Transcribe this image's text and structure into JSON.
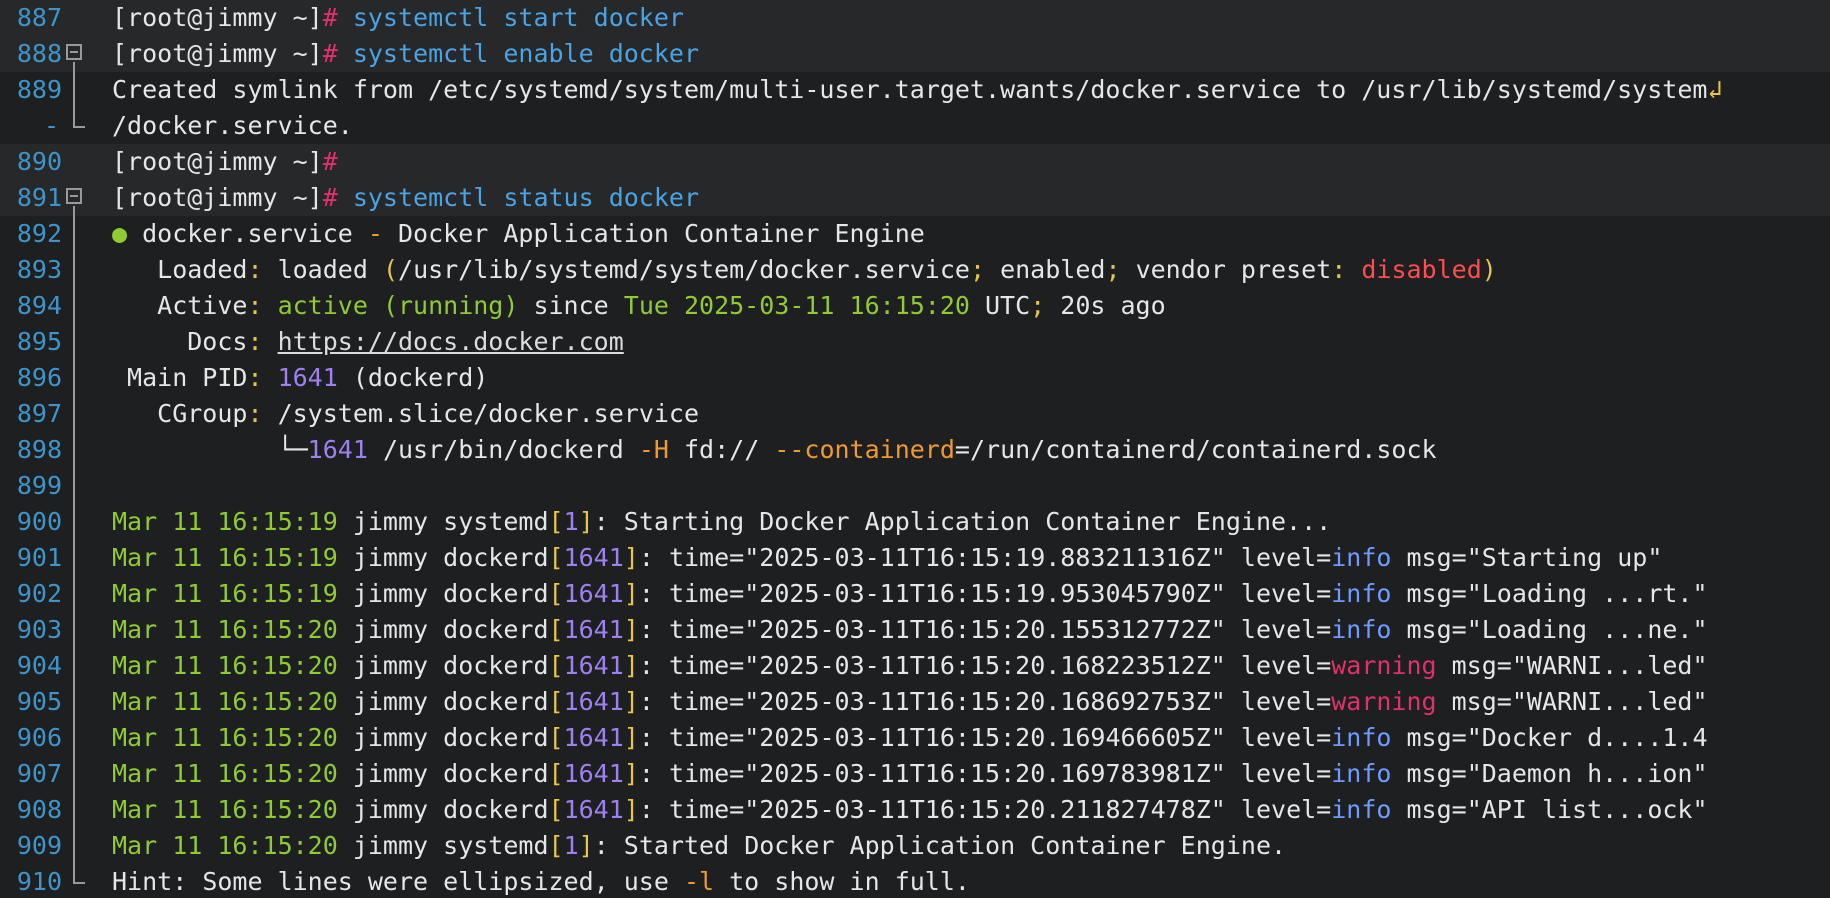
{
  "lines": [
    {
      "num": "887",
      "prompt": "[root@jimmy ~]",
      "hash": "#",
      "cmd": " systemctl start docker"
    },
    {
      "num": "888",
      "prompt": "[root@jimmy ~]",
      "hash": "#",
      "cmd": " systemctl enable docker"
    },
    {
      "num": "889",
      "text": "Created symlink from /etc/systemd/system/multi-user.target.wants/docker.service to /usr/lib/systemd/system",
      "wrap": "↲"
    },
    {
      "num": "-",
      "text": "/docker.service."
    },
    {
      "num": "890",
      "prompt": "[root@jimmy ~]",
      "hash": "#"
    },
    {
      "num": "891",
      "prompt": "[root@jimmy ~]",
      "hash": "#",
      "cmd": " systemctl status docker"
    },
    {
      "num": "892",
      "bullet": "●",
      "name": " docker.service",
      "sep": " - ",
      "desc": "Docker Application Container Engine"
    },
    {
      "num": "893",
      "label": "   Loaded",
      "colon": ":",
      "v1": " loaded ",
      "p1": "(",
      "path": "/usr/lib/systemd/system/docker.service",
      "semi1": ";",
      "en": " enabled",
      "semi2": ";",
      "vp": " vendor preset",
      "colon2": ":",
      "dis": " disabled",
      "p2": ")"
    },
    {
      "num": "894",
      "label": "   Active",
      "colon": ":",
      "state": " active (running)",
      "since": " since ",
      "date": "Tue 2025-03-11 16:15:20",
      "tz": " UTC",
      "semi": ";",
      "ago": " 20s ago"
    },
    {
      "num": "895",
      "label": "     Docs",
      "colon": ":",
      "link": "https://docs.docker.com"
    },
    {
      "num": "896",
      "label": " Main PID",
      "colon": ":",
      "pid": " 1641",
      "paren": " (dockerd)"
    },
    {
      "num": "897",
      "label": "   CGroup",
      "colon": ":",
      "cg": " /system.slice/docker.service"
    },
    {
      "num": "898",
      "tree": "           └─",
      "pid": "1641",
      "cmd1": " /usr/bin/dockerd ",
      "flag1": "-H",
      "arg1": " fd:// ",
      "flag2": "--containerd",
      "arg2": "=/run/containerd/containerd.sock"
    },
    {
      "num": "899"
    },
    {
      "num": "900",
      "ts": "Mar 11 16:15:19",
      "host": " jimmy systemd",
      "pid": "1",
      "msg": ": Starting Docker Application Container Engine..."
    },
    {
      "num": "901",
      "ts": "Mar 11 16:15:19",
      "host": " jimmy dockerd",
      "pid": "1641",
      "time": "\"2025-03-11T16:15:19.883211316Z\"",
      "level": "info",
      "msg": "\"Starting up\""
    },
    {
      "num": "902",
      "ts": "Mar 11 16:15:19",
      "host": " jimmy dockerd",
      "pid": "1641",
      "time": "\"2025-03-11T16:15:19.953045790Z\"",
      "level": "info",
      "msg": "\"Loading ...rt.\""
    },
    {
      "num": "903",
      "ts": "Mar 11 16:15:20",
      "host": " jimmy dockerd",
      "pid": "1641",
      "time": "\"2025-03-11T16:15:20.155312772Z\"",
      "level": "info",
      "msg": "\"Loading ...ne.\""
    },
    {
      "num": "904",
      "ts": "Mar 11 16:15:20",
      "host": " jimmy dockerd",
      "pid": "1641",
      "time": "\"2025-03-11T16:15:20.168223512Z\"",
      "level": "warning",
      "msg": "\"WARNI...led\""
    },
    {
      "num": "905",
      "ts": "Mar 11 16:15:20",
      "host": " jimmy dockerd",
      "pid": "1641",
      "time": "\"2025-03-11T16:15:20.168692753Z\"",
      "level": "warning",
      "msg": "\"WARNI...led\""
    },
    {
      "num": "906",
      "ts": "Mar 11 16:15:20",
      "host": " jimmy dockerd",
      "pid": "1641",
      "time": "\"2025-03-11T16:15:20.169466605Z\"",
      "level": "info",
      "msg": "\"Docker d....1.4"
    },
    {
      "num": "907",
      "ts": "Mar 11 16:15:20",
      "host": " jimmy dockerd",
      "pid": "1641",
      "time": "\"2025-03-11T16:15:20.169783981Z\"",
      "level": "info",
      "msg": "\"Daemon h...ion\""
    },
    {
      "num": "908",
      "ts": "Mar 11 16:15:20",
      "host": " jimmy dockerd",
      "pid": "1641",
      "time": "\"2025-03-11T16:15:20.211827478Z\"",
      "level": "info",
      "msg": "\"API list...ock\""
    },
    {
      "num": "909",
      "ts": "Mar 11 16:15:20",
      "host": " jimmy systemd",
      "pid": "1",
      "msg": ": Started Docker Application Container Engine."
    },
    {
      "num": "910",
      "hint": "Hint",
      "hint_rest": ": Some lines were ellipsized, use ",
      "flag": "-l",
      "hint_end": " to show in full."
    }
  ],
  "tokens": {
    "lb": "[",
    "rb": "]",
    "time_key": " time=",
    "level_key": " level=",
    "msg_key": " msg="
  }
}
